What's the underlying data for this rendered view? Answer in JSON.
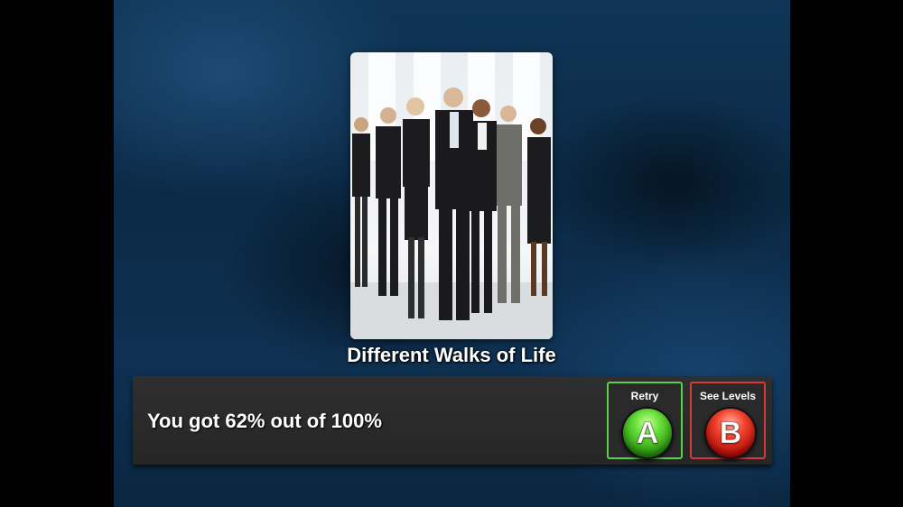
{
  "card": {
    "caption": "Different Walks of Life",
    "image_desc": "group-of-business-people-photo"
  },
  "result": {
    "score_text": "You got 62% out of 100%"
  },
  "buttons": {
    "retry": {
      "label": "Retry",
      "glyph": "A",
      "color": "#5ad04a"
    },
    "levels": {
      "label": "See Levels",
      "glyph": "B",
      "color": "#d63a3a"
    }
  }
}
